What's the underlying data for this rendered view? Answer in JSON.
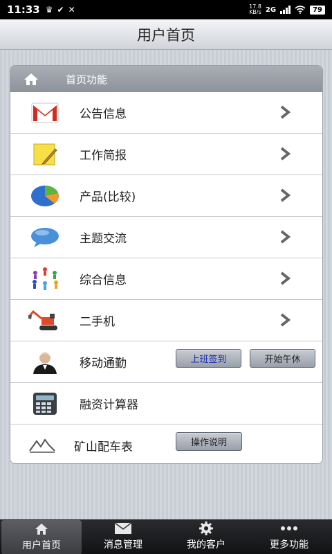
{
  "status": {
    "time": "11:33",
    "net_speed": "17.8",
    "net_unit": "KB/s",
    "net_type": "2G",
    "battery": "79"
  },
  "header": {
    "title": "用户首页"
  },
  "section": {
    "title": "首页功能"
  },
  "items": [
    {
      "label": "公告信息",
      "icon": "mail-icon"
    },
    {
      "label": "工作简报",
      "icon": "note-icon"
    },
    {
      "label": "产品(比较)",
      "icon": "pie-chart-icon"
    },
    {
      "label": "主题交流",
      "icon": "chat-bubble-icon"
    },
    {
      "label": "综合信息",
      "icon": "people-circle-icon"
    },
    {
      "label": "二手机",
      "icon": "excavator-icon"
    },
    {
      "label": "移动通勤",
      "icon": "person-icon"
    },
    {
      "label": "融资计算器",
      "icon": "calculator-icon"
    },
    {
      "label": "矿山配车表",
      "icon": "mountain-icon"
    }
  ],
  "buttons": {
    "check_in": "上班签到",
    "lunch_break": "开始午休",
    "instructions": "操作说明"
  },
  "colors": {
    "check_in_text": "#1a2fb0"
  },
  "tabs": [
    {
      "label": "用户首页",
      "icon": "home-icon"
    },
    {
      "label": "消息管理",
      "icon": "envelope-icon"
    },
    {
      "label": "我的客户",
      "icon": "gear-icon"
    },
    {
      "label": "更多功能",
      "icon": "more-icon"
    }
  ]
}
